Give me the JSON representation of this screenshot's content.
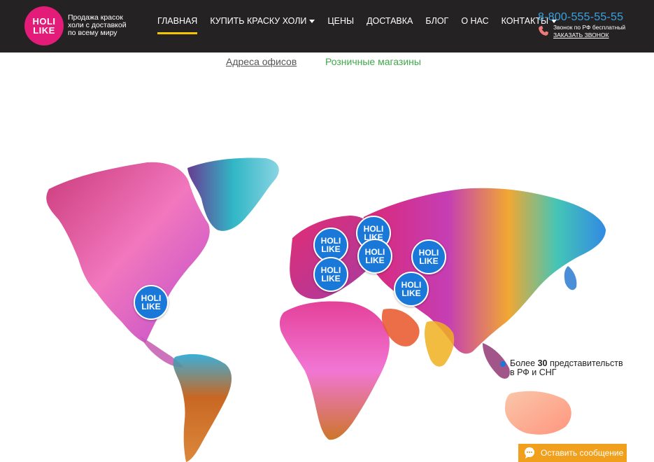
{
  "header": {
    "logo": {
      "line1": "HOLI",
      "line2": "LIKE"
    },
    "tagline": [
      "Продажа красок",
      "холи с доставкой",
      "по всему миру"
    ],
    "nav": [
      {
        "label": "Главная",
        "active": true,
        "dropdown": false
      },
      {
        "label": "Купить краску холи",
        "active": false,
        "dropdown": true
      },
      {
        "label": "Цены",
        "active": false,
        "dropdown": false
      },
      {
        "label": "Доставка",
        "active": false,
        "dropdown": false
      },
      {
        "label": "Блог",
        "active": false,
        "dropdown": false
      },
      {
        "label": "О нас",
        "active": false,
        "dropdown": false
      },
      {
        "label": "Контакты",
        "active": false,
        "dropdown": true
      }
    ],
    "phone": "8-800-555-55-55",
    "phone_note": "Звонок по РФ бесплатный",
    "callback_label": "ЗАКАЗАТЬ ЗВОНОК"
  },
  "tabs": {
    "offices": "Адреса офисов",
    "retail": "Розничные магазины"
  },
  "marker_label": {
    "line1": "HOLI",
    "line2": "LIKE"
  },
  "info": {
    "prefix": "Более ",
    "number": "30",
    "suffix": " представительств",
    "line2": "в РФ и СНГ"
  },
  "chat_button": "Оставить сообщение",
  "colors": {
    "header_bg": "#252223",
    "logo": "#e31c79",
    "active_underline": "#f2c500",
    "phone": "#3aa3e3",
    "marker": "#1a78d9",
    "tab_retail": "#3fa84a",
    "chat_button": "#f0a01c"
  }
}
